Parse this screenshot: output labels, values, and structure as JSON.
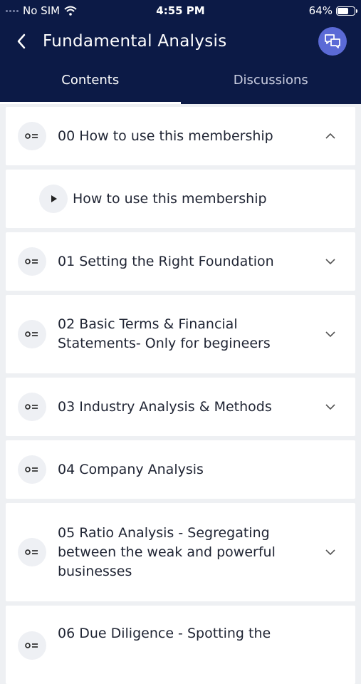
{
  "status_bar": {
    "carrier": "No SIM",
    "time": "4:55 PM",
    "battery": "64%",
    "battery_level": 0.64
  },
  "header": {
    "title": "Fundamental Analysis"
  },
  "tabs": [
    {
      "label": "Contents",
      "active": true
    },
    {
      "label": "Discussions",
      "active": false
    }
  ],
  "sections": [
    {
      "title": "00 How to use this membership",
      "chevron": "up"
    },
    {
      "title": "How to use this membership",
      "type": "lesson"
    },
    {
      "title": "01 Setting the Right Foundation",
      "chevron": "down"
    },
    {
      "title": "02 Basic Terms & Financial Statements- Only for begineers",
      "chevron": "down"
    },
    {
      "title": "03 Industry Analysis & Methods",
      "chevron": "down"
    },
    {
      "title": "04 Company Analysis",
      "chevron": "none"
    },
    {
      "title": "05 Ratio Analysis - Segregating between the weak and powerful businesses",
      "chevron": "down"
    },
    {
      "title": "06 Due Diligence - Spotting the",
      "chevron": "none"
    }
  ]
}
